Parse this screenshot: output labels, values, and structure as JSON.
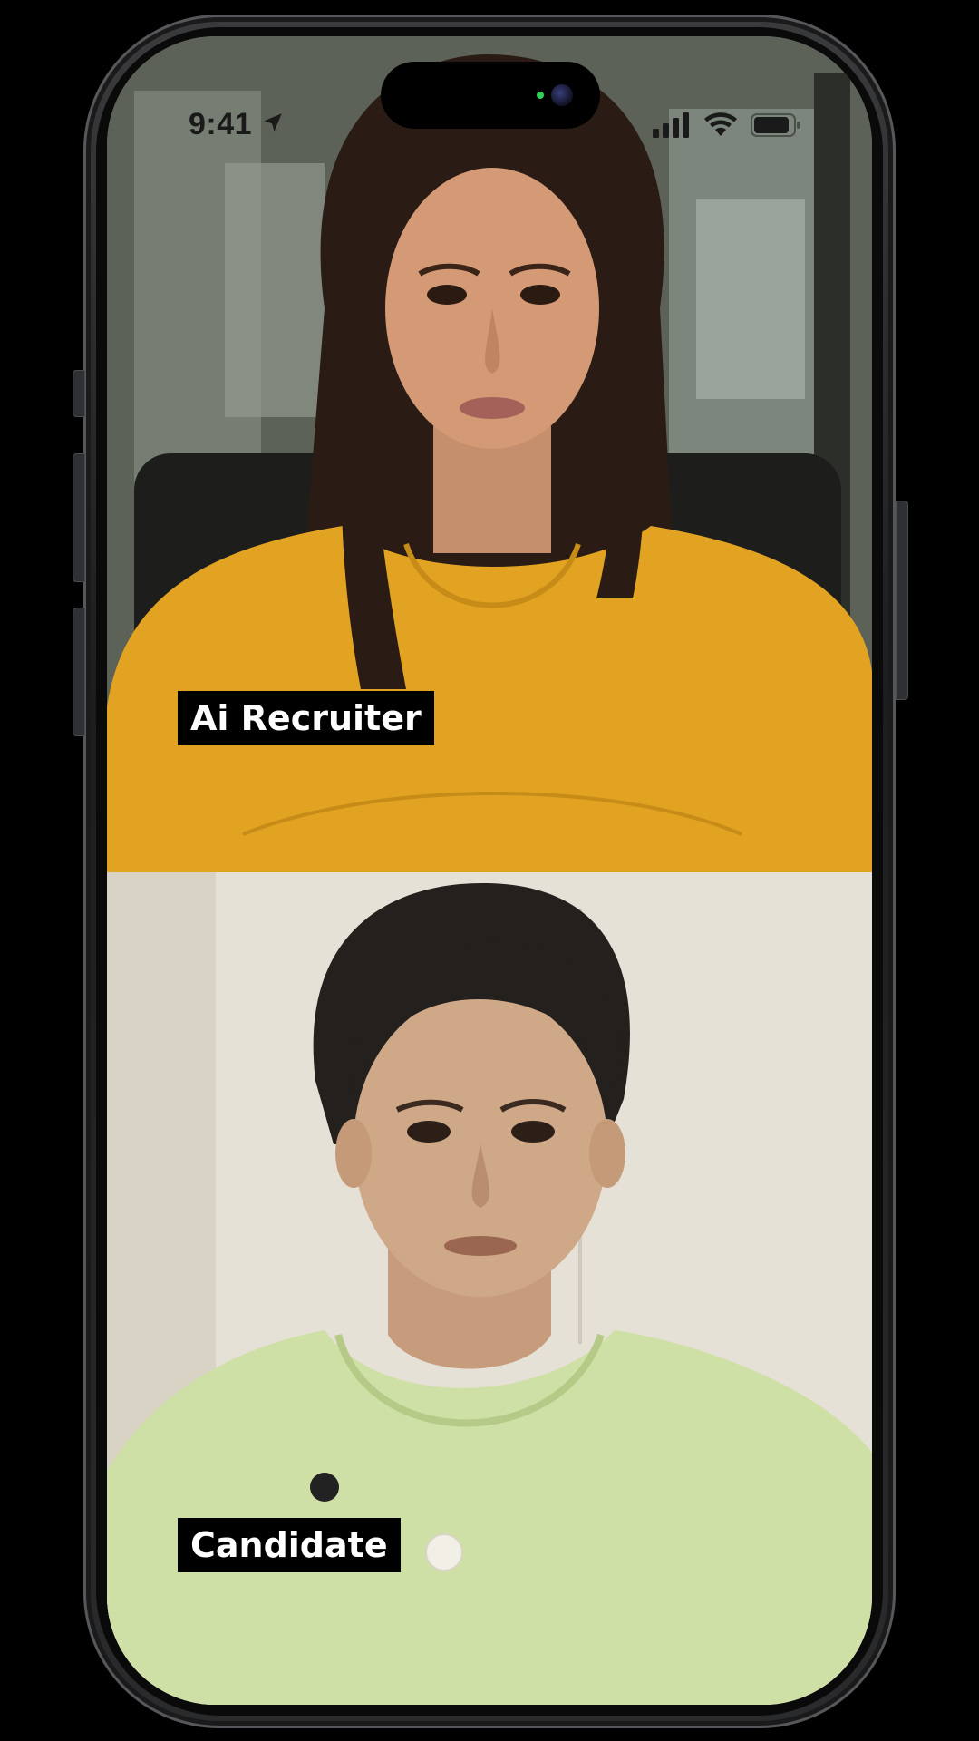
{
  "status_bar": {
    "time": "9:41",
    "icons": [
      "location-arrow-icon",
      "cellular-signal-icon",
      "wifi-icon",
      "battery-icon"
    ]
  },
  "participants": [
    {
      "role": "top",
      "label": "Ai Recruiter"
    },
    {
      "role": "bottom",
      "label": "Candidate"
    }
  ],
  "colors": {
    "label_background": "#000000",
    "label_text": "#ffffff",
    "recruiter_shirt": "#e3a322",
    "candidate_shirt": "#cfe0a6"
  }
}
